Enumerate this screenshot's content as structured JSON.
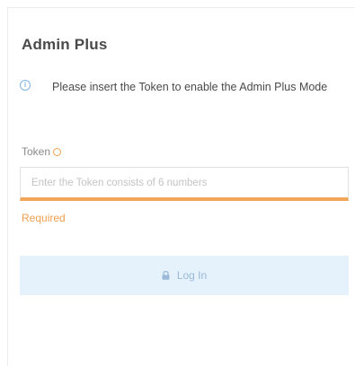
{
  "panel": {
    "title": "Admin Plus",
    "info_text": "Please insert the Token to enable the Admin Plus Mode"
  },
  "form": {
    "token_label": "Token",
    "token_placeholder": "Enter the Token consists of 6 numbers",
    "token_value": "",
    "error_text": "Required",
    "login_label": "Log In"
  },
  "icons": {
    "info": "info-circle-icon",
    "required": "required-circle-icon",
    "login": "lock-icon"
  },
  "colors": {
    "accent_warning": "#f2a65a",
    "info_blue": "#7fb3e6",
    "button_bg": "#e6f2fb",
    "button_text": "#9bb8d8",
    "title_text": "#4a4a4a"
  }
}
